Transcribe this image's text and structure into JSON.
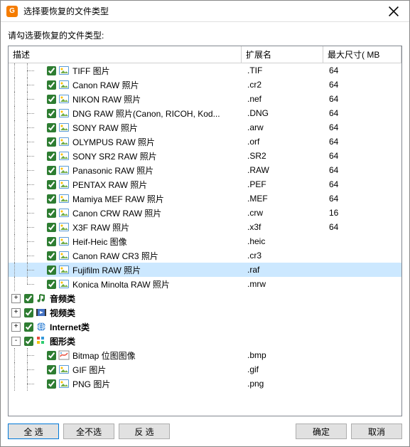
{
  "window": {
    "title": "选择要恢复的文件类型"
  },
  "prompt": "请勾选要恢复的文件类型:",
  "columns": {
    "desc": "描述",
    "ext": "扩展名",
    "size": "最大尺寸( MB"
  },
  "rows": [
    {
      "depth": 2,
      "exp": "",
      "chk": true,
      "icon": "img",
      "label": "TIFF 图片",
      "ext": ".TIF",
      "size": "64"
    },
    {
      "depth": 2,
      "exp": "",
      "chk": true,
      "icon": "img",
      "label": "Canon RAW 照片",
      "ext": ".cr2",
      "size": "64"
    },
    {
      "depth": 2,
      "exp": "",
      "chk": true,
      "icon": "img",
      "label": "NIKON RAW 照片",
      "ext": ".nef",
      "size": "64"
    },
    {
      "depth": 2,
      "exp": "",
      "chk": true,
      "icon": "img",
      "label": "DNG RAW 照片(Canon, RICOH, Kod...",
      "ext": ".DNG",
      "size": "64"
    },
    {
      "depth": 2,
      "exp": "",
      "chk": true,
      "icon": "img",
      "label": "SONY RAW 照片",
      "ext": ".arw",
      "size": "64"
    },
    {
      "depth": 2,
      "exp": "",
      "chk": true,
      "icon": "img",
      "label": "OLYMPUS RAW 照片",
      "ext": ".orf",
      "size": "64"
    },
    {
      "depth": 2,
      "exp": "",
      "chk": true,
      "icon": "img",
      "label": "SONY SR2 RAW 照片",
      "ext": ".SR2",
      "size": "64"
    },
    {
      "depth": 2,
      "exp": "",
      "chk": true,
      "icon": "img",
      "label": "Panasonic RAW 照片",
      "ext": ".RAW",
      "size": "64"
    },
    {
      "depth": 2,
      "exp": "",
      "chk": true,
      "icon": "img",
      "label": "PENTAX RAW 照片",
      "ext": ".PEF",
      "size": "64"
    },
    {
      "depth": 2,
      "exp": "",
      "chk": true,
      "icon": "img",
      "label": "Mamiya MEF RAW 照片",
      "ext": ".MEF",
      "size": "64"
    },
    {
      "depth": 2,
      "exp": "",
      "chk": true,
      "icon": "img",
      "label": "Canon CRW RAW 照片",
      "ext": ".crw",
      "size": "16"
    },
    {
      "depth": 2,
      "exp": "",
      "chk": true,
      "icon": "img",
      "label": "X3F RAW 照片",
      "ext": ".x3f",
      "size": "64"
    },
    {
      "depth": 2,
      "exp": "",
      "chk": true,
      "icon": "img",
      "label": "Heif-Heic 图像",
      "ext": ".heic",
      "size": ""
    },
    {
      "depth": 2,
      "exp": "",
      "chk": true,
      "icon": "img",
      "label": "Canon RAW CR3 照片",
      "ext": ".cr3",
      "size": ""
    },
    {
      "depth": 2,
      "exp": "",
      "chk": true,
      "icon": "img",
      "label": "Fujifilm RAW 照片",
      "ext": ".raf",
      "size": "",
      "selected": true
    },
    {
      "depth": 2,
      "exp": "",
      "chk": true,
      "icon": "img",
      "label": "Konica Minolta RAW 照片",
      "ext": ".mrw",
      "size": "",
      "last": true
    },
    {
      "depth": 1,
      "exp": "+",
      "chk": true,
      "icon": "audio",
      "label": "音频类",
      "ext": "",
      "size": "",
      "bold": true
    },
    {
      "depth": 1,
      "exp": "+",
      "chk": true,
      "icon": "video",
      "label": "视频类",
      "ext": "",
      "size": "",
      "bold": true
    },
    {
      "depth": 1,
      "exp": "+",
      "chk": true,
      "icon": "net",
      "label": "Internet类",
      "ext": "",
      "size": "",
      "bold": true
    },
    {
      "depth": 1,
      "exp": "-",
      "chk": true,
      "icon": "graphic",
      "label": "图形类",
      "ext": "",
      "size": "",
      "bold": true
    },
    {
      "depth": 2,
      "exp": "",
      "chk": true,
      "icon": "paint",
      "label": "Bitmap 位图图像",
      "ext": ".bmp",
      "size": ""
    },
    {
      "depth": 2,
      "exp": "",
      "chk": true,
      "icon": "img",
      "label": "GIF 图片",
      "ext": ".gif",
      "size": ""
    },
    {
      "depth": 2,
      "exp": "",
      "chk": true,
      "icon": "img",
      "label": "PNG 图片",
      "ext": ".png",
      "size": ""
    }
  ],
  "buttons": {
    "all": "全  选",
    "none": "全不选",
    "invert": "反  选",
    "ok": "确定",
    "cancel": "取消"
  }
}
